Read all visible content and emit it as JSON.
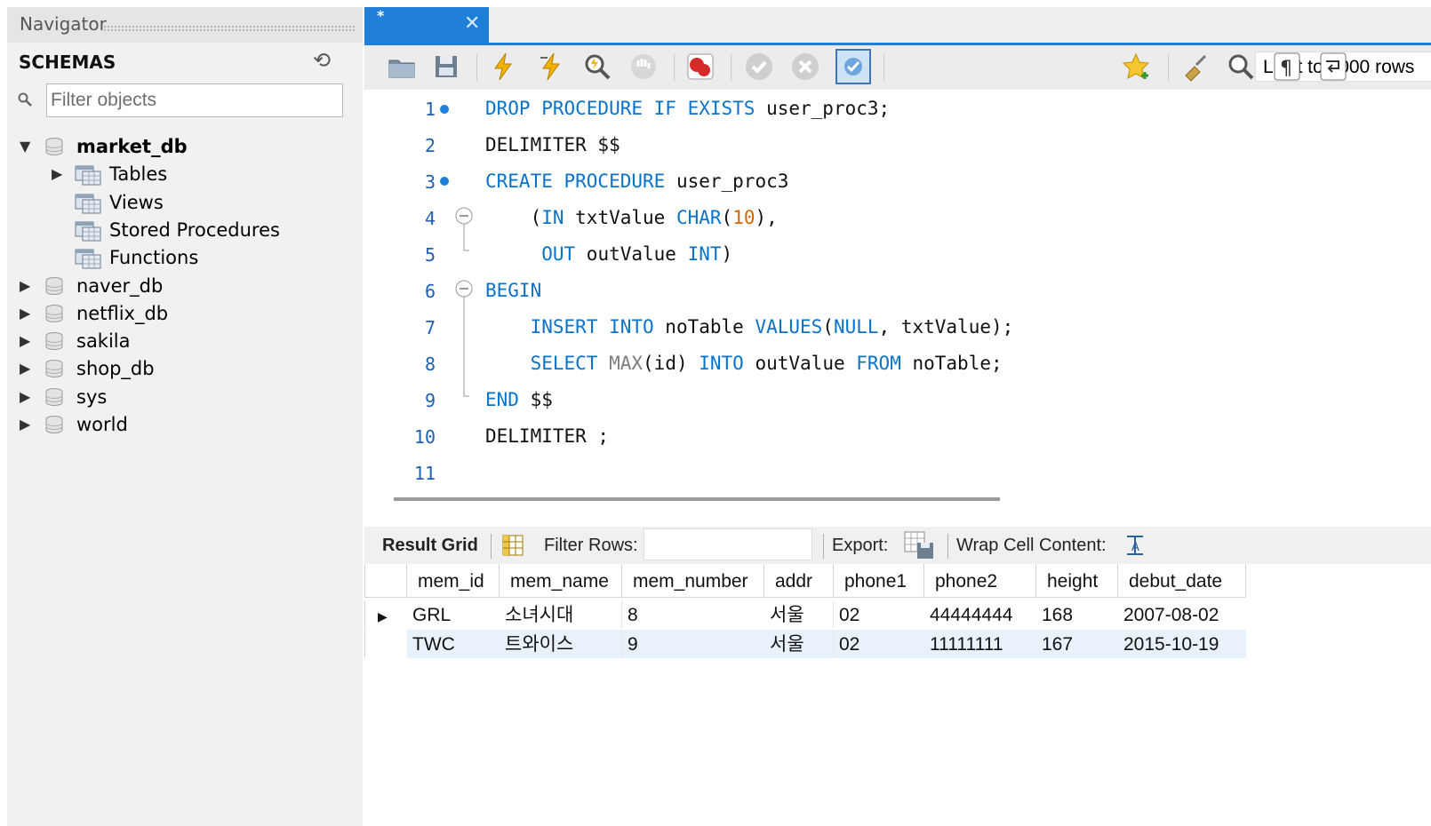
{
  "navigator": {
    "title": "Navigator",
    "section": "SCHEMAS",
    "filter_placeholder": "Filter objects",
    "schemas": [
      {
        "name": "market_db",
        "expanded": true,
        "children": [
          "Tables",
          "Views",
          "Stored Procedures",
          "Functions"
        ]
      },
      {
        "name": "naver_db"
      },
      {
        "name": "netflix_db"
      },
      {
        "name": "sakila"
      },
      {
        "name": "shop_db"
      },
      {
        "name": "sys"
      },
      {
        "name": "world"
      }
    ]
  },
  "editor": {
    "tab_title": "*",
    "limit_select": "Limit to 1000 rows",
    "line_numbers": [
      "1",
      "2",
      "3",
      "4",
      "5",
      "6",
      "7",
      "8",
      "9",
      "10",
      "11"
    ]
  },
  "result": {
    "tab_label": "Result Grid",
    "filter_rows_label": "Filter Rows:",
    "export_label": "Export:",
    "wrap_label": "Wrap Cell Content:",
    "columns": [
      "mem_id",
      "mem_name",
      "mem_number",
      "addr",
      "phone1",
      "phone2",
      "height",
      "debut_date"
    ],
    "rows": [
      [
        "GRL",
        "소녀시대",
        "8",
        "서울",
        "02",
        "44444444",
        "168",
        "2007-08-02"
      ],
      [
        "TWC",
        "트와이스",
        "9",
        "서울",
        "02",
        "11111111",
        "167",
        "2015-10-19"
      ]
    ]
  },
  "colors": {
    "accent": "#1f7fd9",
    "keyword": "#0a73c9",
    "number": "#d06a00"
  }
}
